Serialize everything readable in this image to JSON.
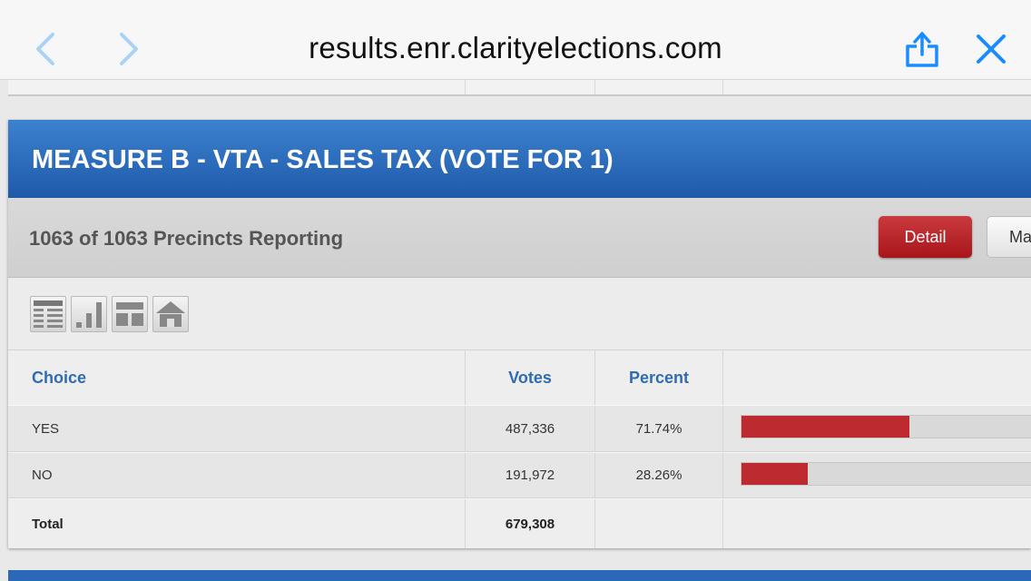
{
  "browser": {
    "url": "results.enr.clarityelections.com",
    "icons": [
      "chevron-left-icon",
      "chevron-right-icon",
      "share-icon",
      "close-icon"
    ],
    "accent_color": "#1a8cff"
  },
  "contest": {
    "title": "MEASURE B - VTA - SALES TAX (VOTE FOR 1)",
    "precincts": "1063 of 1063 Precincts Reporting",
    "detail_label": "Detail",
    "map_label": "Ma",
    "view_icons": [
      "table-view-icon",
      "bar-chart-icon",
      "layout-icon",
      "home-icon"
    ],
    "table": {
      "headers": {
        "choice": "Choice",
        "votes": "Votes",
        "percent": "Percent"
      },
      "rows": [
        {
          "choice": "YES",
          "votes": "487,336",
          "percent": "71.74%",
          "share": 0.7174
        },
        {
          "choice": "NO",
          "votes": "191,972",
          "percent": "28.26%",
          "share": 0.2826
        }
      ],
      "total": {
        "label": "Total",
        "votes": "679,308"
      }
    },
    "colors": {
      "header": "#2563b0",
      "bar": "#bd2a2f",
      "detail_button": "#b8242a"
    }
  }
}
